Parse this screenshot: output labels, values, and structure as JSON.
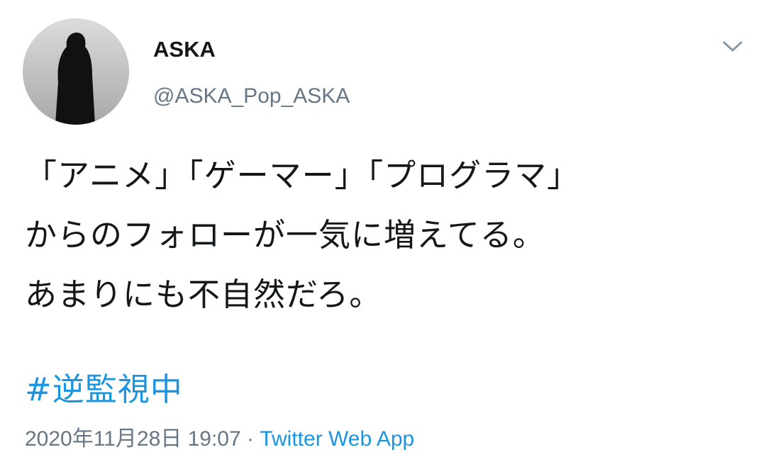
{
  "tweet": {
    "author": {
      "display_name": "ASKA",
      "handle": "@ASKA_Pop_ASKA",
      "avatar_icon": "avatar-silhouette"
    },
    "menu_icon": "chevron-down-icon",
    "text_lines": [
      "「アニメ」「ゲーマー」「プログラマ」",
      "からのフォローが一気に増えてる。",
      "あまりにも不自然だろ。"
    ],
    "hashtag": "#逆監視中",
    "timestamp": "2020年11月28日 19:07",
    "separator": " · ",
    "source": "Twitter Web App",
    "colors": {
      "text": "#14171a",
      "secondary": "#657786",
      "link": "#1b95e0",
      "background": "#ffffff"
    }
  }
}
